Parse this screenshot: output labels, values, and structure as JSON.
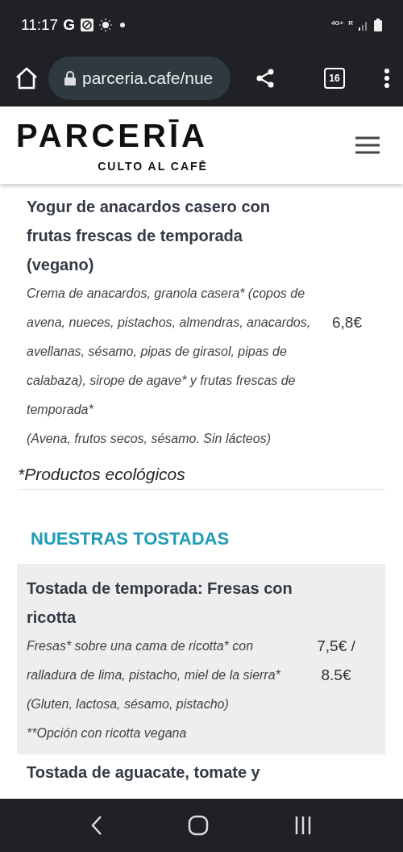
{
  "status_bar": {
    "time": "11:17",
    "google_letter": "G",
    "network": "4G+",
    "roaming": "R"
  },
  "browser": {
    "url": "parceria.cafe/nue",
    "tab_count": "16"
  },
  "site_header": {
    "logo": "PARCERĪA",
    "tagline": "CULTO AL CAFĒ"
  },
  "menu_items": [
    {
      "title": "Yogur de anacardos casero con frutas frescas de temporada (vegano)",
      "shaded": false,
      "description": [
        "Crema de anacardos, granola casera* (copos de avena, nueces, pistachos, almendras, anacardos, avellanas, sésamo, pipas de girasol, pipas de calabaza), sirope de agave* y frutas frescas de temporada*",
        "(Avena, frutos secos, sésamo. Sin lácteos)"
      ],
      "price": "6,8€"
    }
  ],
  "footnote": "*Productos ecológicos",
  "section": {
    "heading": "NUESTRAS TOSTADAS",
    "items": [
      {
        "title": "Tostada de temporada: Fresas con ricotta",
        "shaded": true,
        "description": [
          "Fresas* sobre una cama de ricotta* con ralladura de lima, pistacho, miel de la sierra*",
          "(Gluten, lactosa, sésamo, pistacho)",
          "**Opción con ricotta vegana"
        ],
        "price": "7,5€ / 8.5€"
      },
      {
        "title": "Tostada de aguacate, tomate y",
        "shaded": false
      }
    ]
  }
}
